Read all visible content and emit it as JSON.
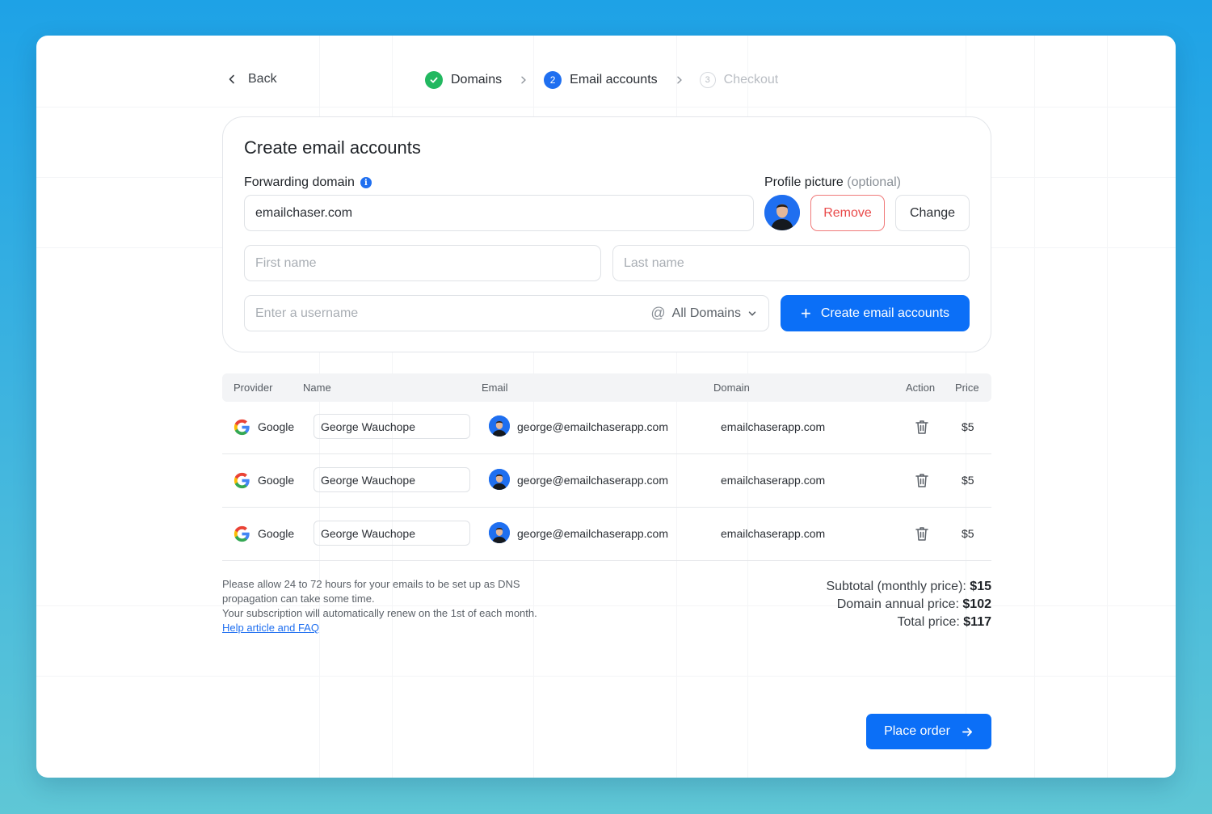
{
  "nav": {
    "back_label": "Back",
    "steps": [
      {
        "number": "",
        "label": "Domains",
        "state": "done"
      },
      {
        "number": "2",
        "label": "Email accounts",
        "state": "active"
      },
      {
        "number": "3",
        "label": "Checkout",
        "state": "todo"
      }
    ]
  },
  "form": {
    "title": "Create email accounts",
    "forwarding_label": "Forwarding domain",
    "forwarding_value": "emailchaser.com",
    "profile_picture_label": "Profile picture",
    "profile_picture_optional": "(optional)",
    "remove_label": "Remove",
    "change_label": "Change",
    "first_name_placeholder": "First name",
    "last_name_placeholder": "Last name",
    "username_placeholder": "Enter a username",
    "domain_select_at": "@",
    "domain_select_value": "All Domains",
    "create_button_label": "Create email accounts"
  },
  "table": {
    "headers": {
      "provider": "Provider",
      "name": "Name",
      "email": "Email",
      "domain": "Domain",
      "action": "Action",
      "price": "Price"
    },
    "rows": [
      {
        "provider": "Google",
        "name": "George Wauchope",
        "email": "george@emailchaserapp.com",
        "domain": "emailchaserapp.com",
        "price": "$5"
      },
      {
        "provider": "Google",
        "name": "George Wauchope",
        "email": "george@emailchaserapp.com",
        "domain": "emailchaserapp.com",
        "price": "$5"
      },
      {
        "provider": "Google",
        "name": "George Wauchope",
        "email": "george@emailchaserapp.com",
        "domain": "emailchaserapp.com",
        "price": "$5"
      }
    ]
  },
  "footer": {
    "note_line1": "Please allow 24 to 72 hours for your emails to be set up as DNS",
    "note_line2": "propagation can take some time.",
    "note_line3": "Your subscription will automatically renew on the 1st of each month.",
    "help_link": "Help article and FAQ",
    "subtotal_label": "Subtotal (monthly price):",
    "subtotal_value": "$15",
    "domain_annual_label": "Domain annual price:",
    "domain_annual_value": "$102",
    "total_label": "Total price:",
    "total_value": "$117",
    "place_order_label": "Place order"
  },
  "colors": {
    "accent": "#0b6ff7",
    "success": "#22b860",
    "danger": "#e94a4a"
  }
}
